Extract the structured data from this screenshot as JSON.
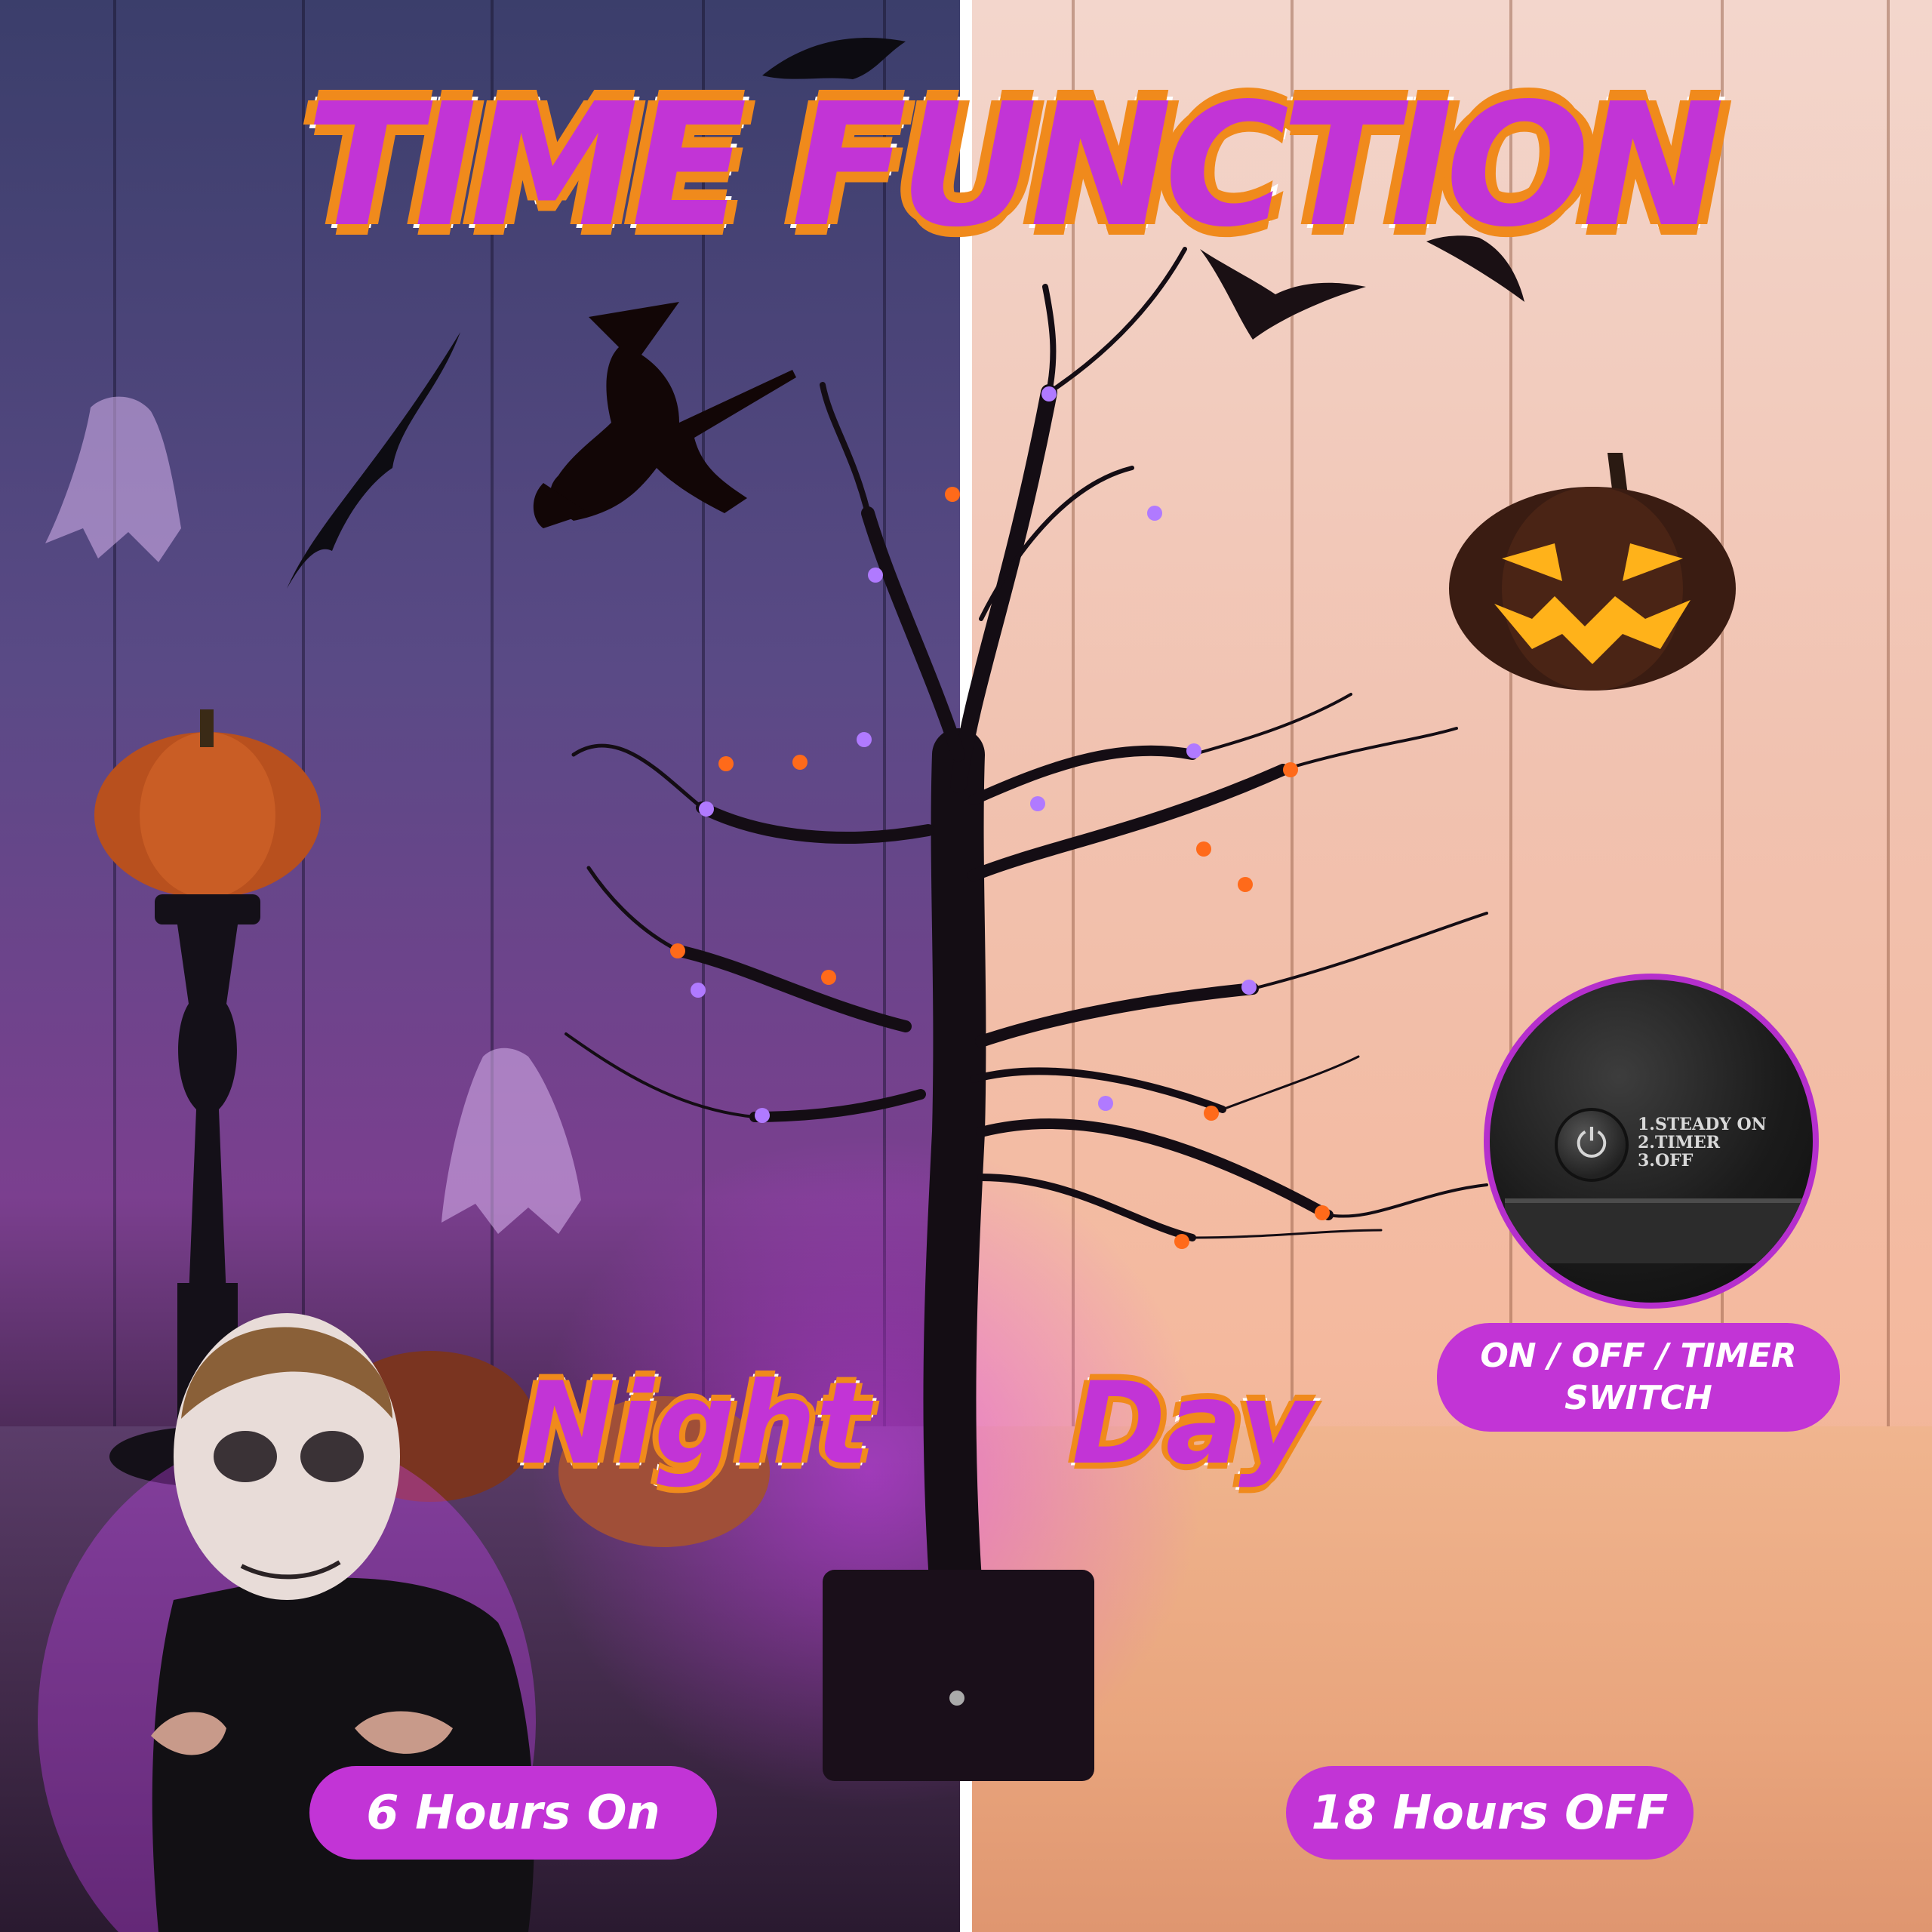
{
  "title": "TIME FUNCTION",
  "night_label": "Night",
  "day_label": "Day",
  "switch_badge": {
    "line1": "ON / OFF / TIMER",
    "line2": "SWITCH"
  },
  "switch_panel": {
    "mode1": "1.STEADY ON",
    "mode2": "2.TIMER",
    "mode3": "3.OFF"
  },
  "on_duration": "6 Hours On",
  "off_duration": "18 Hours OFF",
  "colors": {
    "accent_purple": "#c234d6",
    "outline_orange": "#f08a1c",
    "light_orange": "#ff6a1a",
    "light_purple": "#a45bff"
  },
  "icons": [
    "bat-icon",
    "witch-icon",
    "ghost-icon",
    "pumpkin-icon",
    "jack-o-lantern-icon",
    "power-icon"
  ]
}
